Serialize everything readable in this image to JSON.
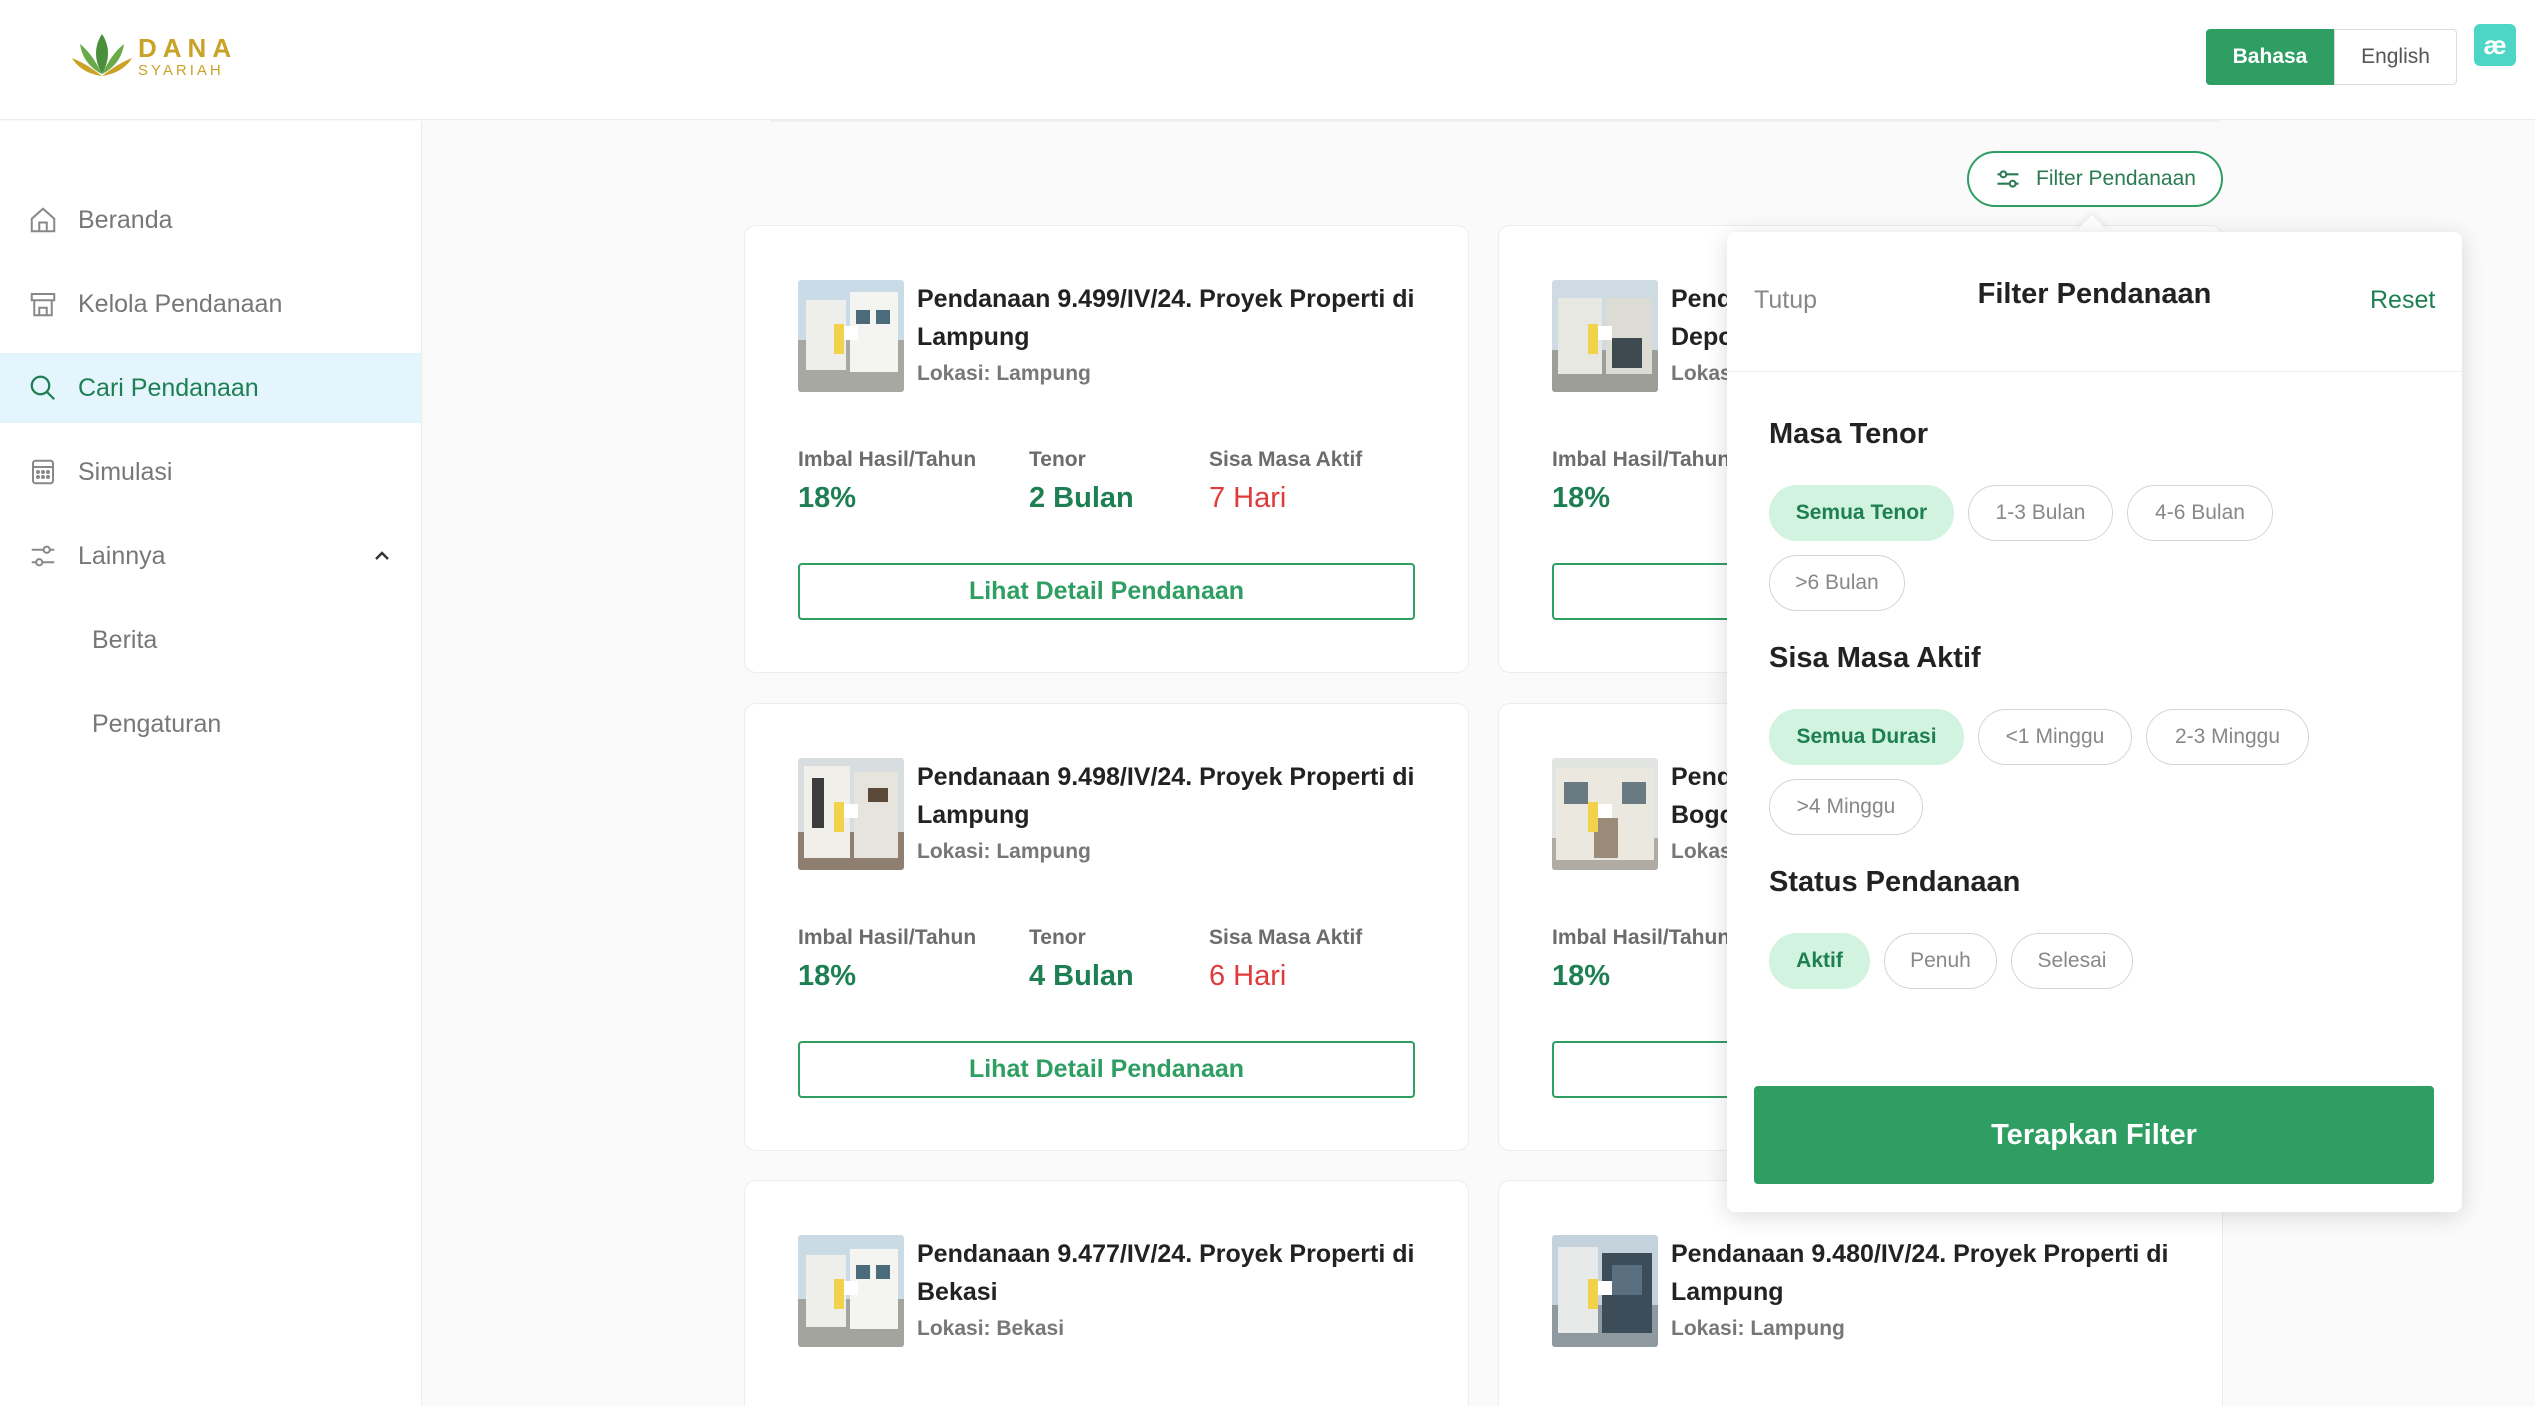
{
  "header": {
    "logo_main": "DANA",
    "logo_sub": "SYARIAH",
    "lang_active": "Bahasa",
    "lang_inactive": "English",
    "ext_logo": "æ"
  },
  "sidebar": {
    "items": [
      {
        "label": "Beranda",
        "icon": "home-icon"
      },
      {
        "label": "Kelola Pendanaan",
        "icon": "store-icon"
      },
      {
        "label": "Cari Pendanaan",
        "icon": "search-icon"
      },
      {
        "label": "Simulasi",
        "icon": "calculator-icon"
      },
      {
        "label": "Lainnya",
        "icon": "sliders-icon"
      },
      {
        "label": "Berita"
      },
      {
        "label": "Pengaturan"
      }
    ],
    "active": "Cari Pendanaan"
  },
  "filter_button": {
    "label": "Filter Pendanaan"
  },
  "labels": {
    "imbal": "Imbal Hasil/Tahun",
    "tenor": "Tenor",
    "sisa": "Sisa Masa Aktif",
    "detail_button": "Lihat Detail Pendanaan"
  },
  "cards": [
    {
      "title": "Pendanaan 9.499/IV/24. Proyek Properti di Lampung",
      "location": "Lokasi: Lampung",
      "imbal": "18%",
      "tenor": "2 Bulan",
      "sisa": "7 Hari"
    },
    {
      "title_partial": [
        "Pend",
        "Depo"
      ],
      "location_partial": "Lokas",
      "imbal": "18%"
    },
    {
      "title": "Pendanaan 9.498/IV/24. Proyek Properti di Lampung",
      "location": "Lokasi: Lampung",
      "imbal": "18%",
      "tenor": "4 Bulan",
      "sisa": "6 Hari"
    },
    {
      "title_partial": [
        "Pend",
        "Bogo"
      ],
      "location_partial": "Lokas",
      "imbal": "18%"
    },
    {
      "title": "Pendanaan 9.477/IV/24. Proyek Properti di Bekasi",
      "location": "Lokasi: Bekasi"
    },
    {
      "title": "Pendanaan 9.480/IV/24. Proyek Properti di Lampung",
      "location": "Lokasi: Lampung"
    }
  ],
  "filter_panel": {
    "close_label": "Tutup",
    "title": "Filter Pendanaan",
    "reset_label": "Reset",
    "sections": [
      {
        "title": "Masa Tenor",
        "options": [
          "Semua Tenor",
          "1-3 Bulan",
          "4-6 Bulan",
          ">6 Bulan"
        ],
        "selected": "Semua Tenor"
      },
      {
        "title": "Sisa Masa Aktif",
        "options": [
          "Semua Durasi",
          "<1 Minggu",
          "2-3 Minggu",
          ">4 Minggu"
        ],
        "selected": "Semua Durasi"
      },
      {
        "title": "Status Pendanaan",
        "options": [
          "Aktif",
          "Penuh",
          "Selesai"
        ],
        "selected": "Aktif"
      }
    ],
    "apply_label": "Terapkan Filter"
  },
  "colors": {
    "primary": "#2e9e63",
    "primary_text": "#1d7f52",
    "danger": "#e03a3a",
    "active_nav_bg": "#e5f5fd",
    "chip_selected_bg": "#d2f3df",
    "logo_gold": "#c9a227"
  }
}
